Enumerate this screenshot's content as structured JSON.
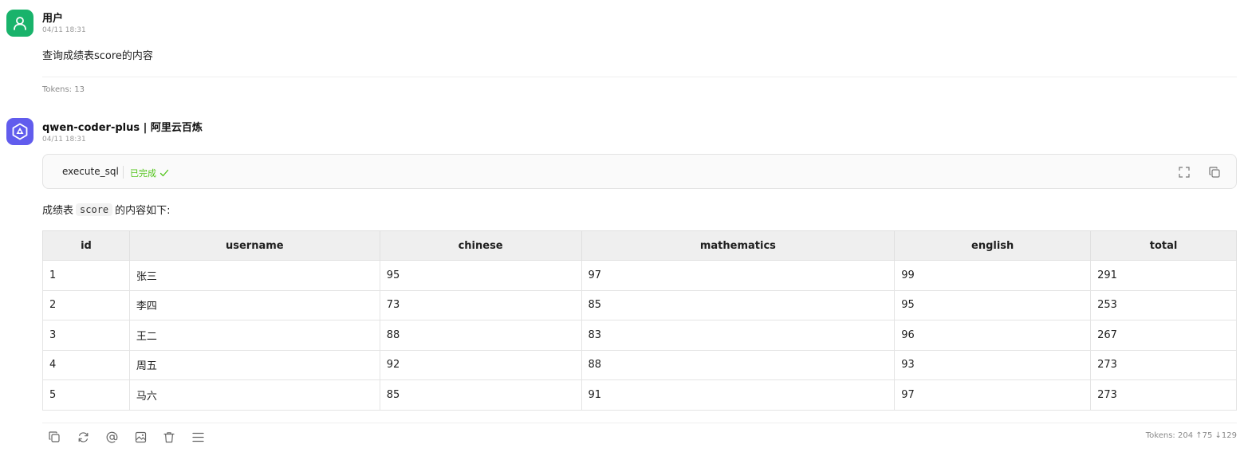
{
  "user_message": {
    "author": "用户",
    "timestamp": "04/11 18:31",
    "text": "查询成绩表score的内容",
    "tokens": "Tokens: 13",
    "avatar_color": "#19b36b"
  },
  "assistant_message": {
    "author": "qwen-coder-plus | 阿里云百炼",
    "timestamp": "04/11 18:31",
    "avatar_color": "#615ced",
    "tool_call": {
      "name": "execute_sql",
      "status": "已完成",
      "status_color": "#52c41a",
      "icons": [
        "fullscreen-icon",
        "copy-icon"
      ]
    },
    "intro_before": "成绩表",
    "intro_code": "score",
    "intro_after": "的内容如下:",
    "table": {
      "headers": [
        "id",
        "username",
        "chinese",
        "mathematics",
        "english",
        "total"
      ],
      "rows": [
        [
          "1",
          "张三",
          "95",
          "97",
          "99",
          "291"
        ],
        [
          "2",
          "李四",
          "73",
          "85",
          "95",
          "253"
        ],
        [
          "3",
          "王二",
          "88",
          "83",
          "96",
          "267"
        ],
        [
          "4",
          "周五",
          "92",
          "88",
          "93",
          "273"
        ],
        [
          "5",
          "马六",
          "85",
          "91",
          "97",
          "273"
        ]
      ]
    },
    "actions": [
      "copy-icon",
      "regenerate-icon",
      "mention-icon",
      "image-icon",
      "delete-icon",
      "menu-icon"
    ],
    "tokens": "Tokens: 204 ↑75 ↓129"
  }
}
